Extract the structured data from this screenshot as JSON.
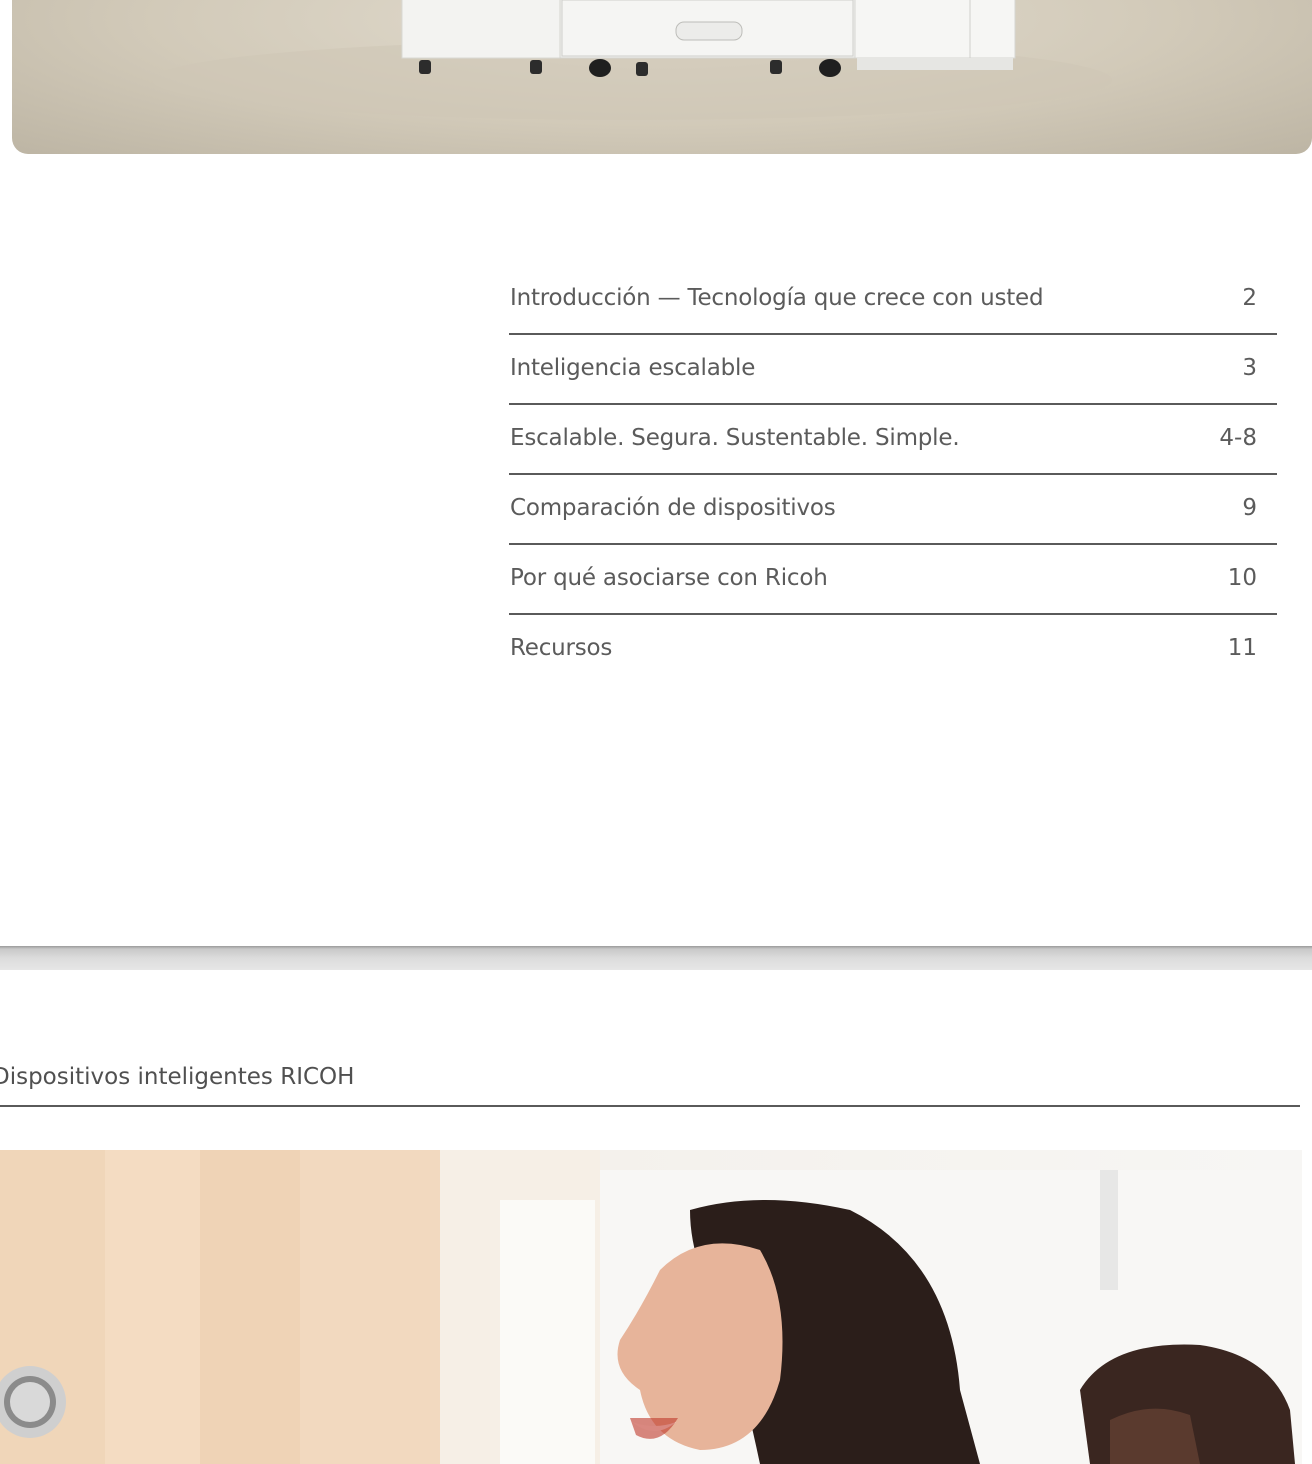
{
  "toc": {
    "items": [
      {
        "title": "Introducción — Tecnología que crece con usted",
        "page": "2"
      },
      {
        "title": "Inteligencia escalable",
        "page": "3"
      },
      {
        "title": "Escalable. Segura. Sustentable. Simple.",
        "page": "4-8"
      },
      {
        "title": "Comparación de dispositivos",
        "page": "9"
      },
      {
        "title": "Por qué asociarse con Ricoh",
        "page": "10"
      },
      {
        "title": "Recursos",
        "page": "11"
      }
    ]
  },
  "page2": {
    "section_header": "Dispositivos inteligentes RICOH"
  }
}
